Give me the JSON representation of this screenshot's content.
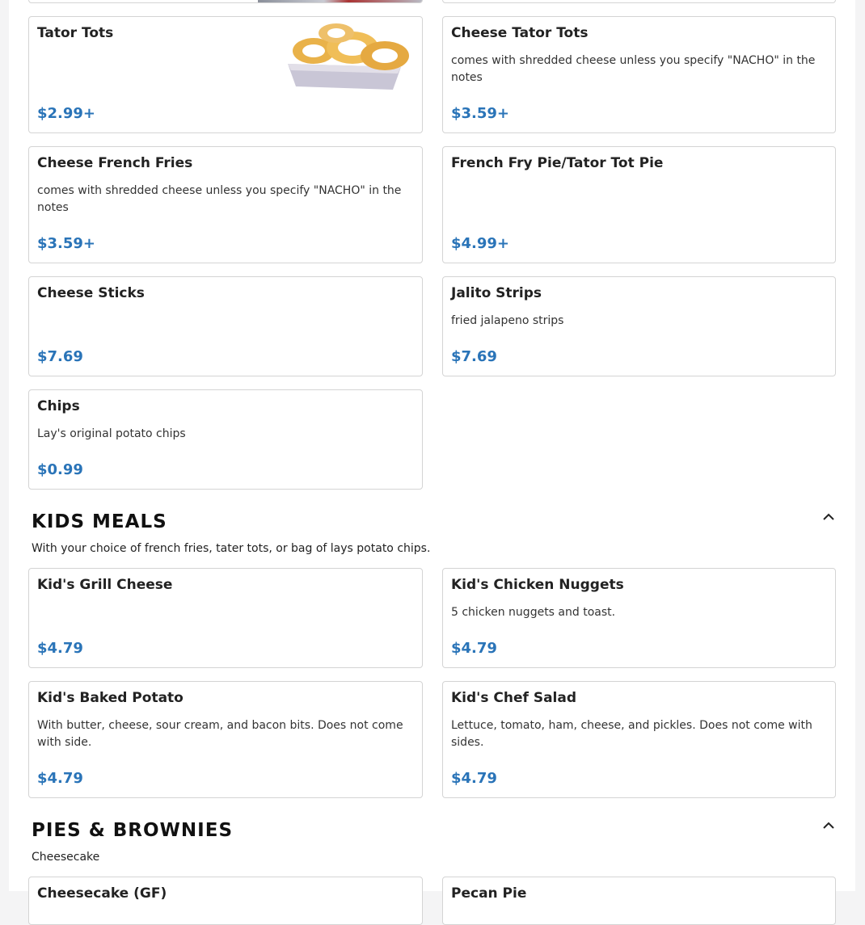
{
  "sections": {
    "sides": {
      "items": [
        {
          "name": "Tator Tots",
          "desc": "",
          "price": "$2.99+"
        },
        {
          "name": "Cheese Tator Tots",
          "desc": "comes with shredded cheese unless you specify \"NACHO\" in the notes",
          "price": "$3.59+"
        },
        {
          "name": "Cheese French Fries",
          "desc": "comes with shredded cheese unless you specify \"NACHO\" in the notes",
          "price": "$3.59+"
        },
        {
          "name": "French Fry Pie/Tator Tot Pie",
          "desc": "",
          "price": "$4.99+"
        },
        {
          "name": "Cheese Sticks",
          "desc": "",
          "price": "$7.69"
        },
        {
          "name": "Jalito Strips",
          "desc": "fried jalapeno strips",
          "price": "$7.69"
        },
        {
          "name": "Chips",
          "desc": "Lay's original potato chips",
          "price": "$0.99"
        }
      ]
    },
    "kids": {
      "title": "KIDS MEALS",
      "subtitle": "With your choice of french fries, tater tots, or bag of lays potato chips.",
      "items": [
        {
          "name": "Kid's Grill Cheese",
          "desc": "",
          "price": "$4.79"
        },
        {
          "name": "Kid's Chicken Nuggets",
          "desc": "5 chicken nuggets and toast.",
          "price": "$4.79"
        },
        {
          "name": "Kid's Baked Potato",
          "desc": "With butter, cheese, sour cream, and bacon bits. Does not come with side.",
          "price": "$4.79"
        },
        {
          "name": "Kid's Chef Salad",
          "desc": "Lettuce, tomato, ham, cheese, and pickles. Does not come with sides.",
          "price": "$4.79"
        }
      ]
    },
    "pies": {
      "title": "PIES & BROWNIES",
      "subtitle": "Cheesecake",
      "items": [
        {
          "name": "Cheesecake (GF)"
        },
        {
          "name": "Pecan Pie"
        }
      ]
    }
  },
  "icons": {
    "collapse": "chevron-up-icon",
    "food_photo": "tator-tots-photo"
  },
  "colors": {
    "price": "#2a74b8",
    "border": "#d4d4d4"
  }
}
